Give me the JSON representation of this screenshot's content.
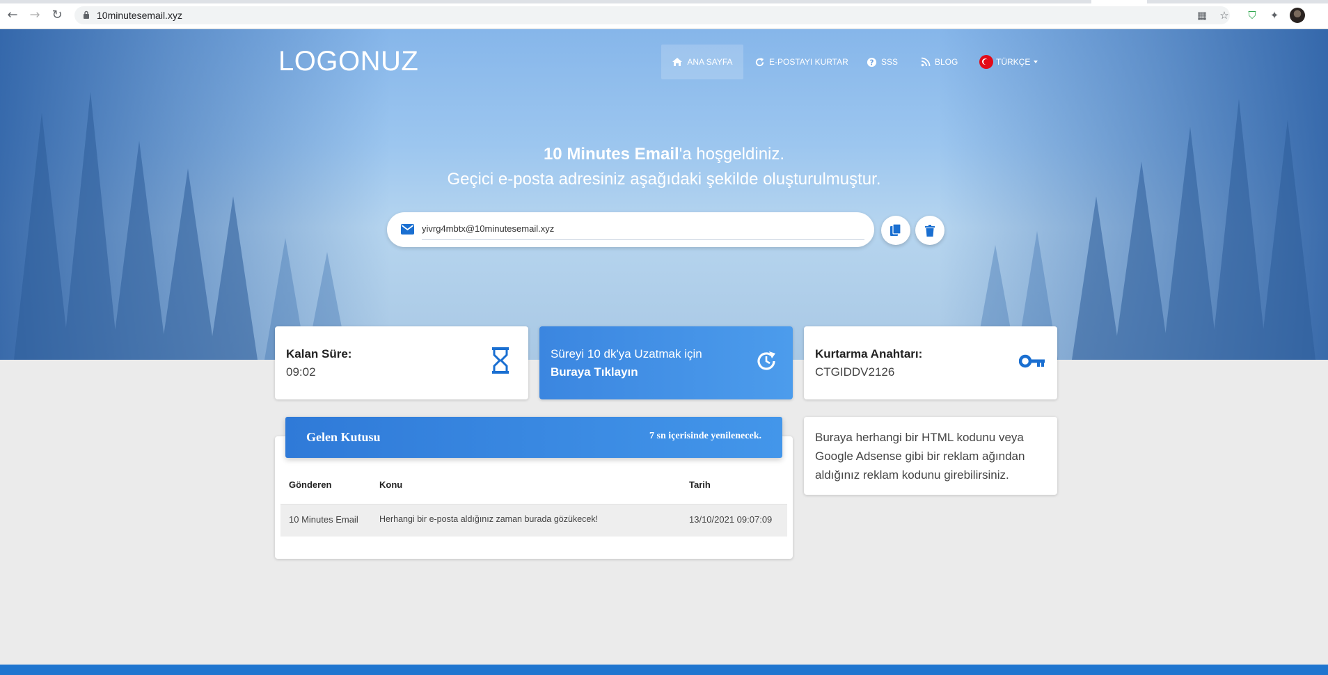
{
  "browser": {
    "url": "10minutesemail.xyz"
  },
  "header": {
    "logo": "LOGONUZ",
    "nav": [
      {
        "label": "ANA SAYFA",
        "icon": "home-icon",
        "active": true
      },
      {
        "label": "E-POSTAYI KURTAR",
        "icon": "refresh-icon"
      },
      {
        "label": "SSS",
        "icon": "help-icon"
      },
      {
        "label": "BLOG",
        "icon": "rss-icon"
      },
      {
        "label": "TÜRKÇE",
        "icon": "turkey-flag-icon"
      }
    ]
  },
  "hero": {
    "welcome_brand": "10 Minutes Email",
    "welcome_suffix": "'a hoşgeldiniz.",
    "subtitle": "Geçici e-posta adresiniz aşağıdaki şekilde oluşturulmuştur.",
    "email": "yivrg4mbtx@10minutesemail.xyz"
  },
  "cards": {
    "time_title": "Kalan Süre:",
    "time_value": "09:02",
    "extend_line1": "Süreyi 10 dk'ya Uzatmak için",
    "extend_line2": "Buraya Tıklayın",
    "recovery_title": "Kurtarma Anahtarı:",
    "recovery_value": "CTGIDDV2126"
  },
  "inbox": {
    "title": "Gelen Kutusu",
    "refresh_text": "7 sn içerisinde yenilenecek.",
    "columns": [
      "Gönderen",
      "Konu",
      "Tarih"
    ],
    "rows": [
      {
        "sender": "10 Minutes Email",
        "subject": "Herhangi bir e-posta aldığınız zaman burada gözükecek!",
        "date": "13/10/2021 09:07:09"
      }
    ]
  },
  "ad": {
    "text": "Buraya herhangi bir HTML kodunu veya Google Adsense gibi bir reklam ağından aldığınız reklam kodunu girebilirsiniz."
  },
  "colors": {
    "primary": "#2f7ad8",
    "accent_icon": "#1a6fd1",
    "footer": "#1f75cf"
  }
}
